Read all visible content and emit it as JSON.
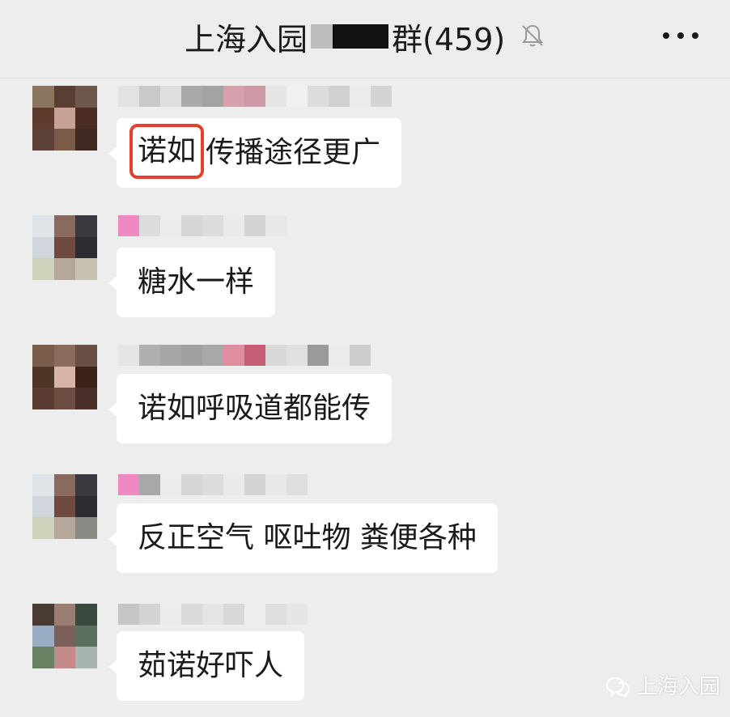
{
  "header": {
    "title_prefix": "上海入园",
    "title_suffix": "群(459)",
    "icons": {
      "mute": "bell-off-icon",
      "more": "more-dots-icon"
    }
  },
  "messages": [
    {
      "text_highlight": "诺如",
      "text": "传播途径更广"
    },
    {
      "text": "糖水一样"
    },
    {
      "text": "诺如呼吸道都能传"
    },
    {
      "text": "反正空气 呕吐物 粪便各种"
    },
    {
      "text": "茹诺好吓人"
    }
  ],
  "watermark": {
    "text": "上海入园",
    "icon": "wechat-channel-icon"
  },
  "colors": {
    "background": "#ededed",
    "bubble": "#ffffff",
    "highlight_border": "#e2412b"
  }
}
